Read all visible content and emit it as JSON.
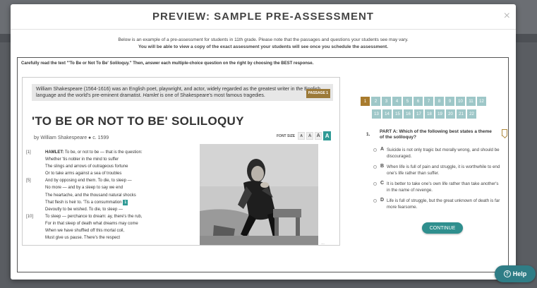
{
  "modal": {
    "title": "PREVIEW: SAMPLE PRE-ASSESSMENT",
    "close": "×",
    "intro_line1": "Below is an example of a pre-assessment for students in 11th grade. Please note that the passages and questions your students see may vary.",
    "intro_line2": "You will be able to view a copy of the exact assessment your students will see once you schedule the assessment."
  },
  "instruction": "Carefully read the text \"'To Be or Not To Be' Soliloquy.\" Then, answer each multiple-choice question on the right by choosing the BEST response.",
  "passage": {
    "bio_part1": "William Shakespeare (1564-1616) was an English poet, playwright, and actor, widely regarded as the greatest writer in the English language and the world's pre-eminent dramatist. ",
    "bio_italic": "Hamlet",
    "bio_part2": " is one of Shakespeare's most famous tragedies.",
    "tag": "PASSAGE 1",
    "title": "'TO BE OR NOT TO BE' SOLILOQUY",
    "author": "by William Shakespeare ● c. 1599",
    "font_size_label": "FONT SIZE",
    "font_btn": "A",
    "vocab_marker": "1",
    "lines": [
      {
        "num": "[1]",
        "speaker": "HAMLET:",
        "text": " To be, or not to be — that is the question:"
      },
      {
        "num": "",
        "speaker": "",
        "text": "Whether 'tis nobler in the mind to suffer"
      },
      {
        "num": "",
        "speaker": "",
        "text": "The slings and arrows of outrageous fortune"
      },
      {
        "num": "",
        "speaker": "",
        "text": "Or to take arms against a sea of troubles"
      },
      {
        "num": "[5]",
        "speaker": "",
        "text": "And by opposing end them. To die, to sleep —"
      },
      {
        "num": "",
        "speaker": "",
        "text": "No more — and by a sleep to say we end"
      },
      {
        "num": "",
        "speaker": "",
        "text": "The heartache, and the thousand natural shocks"
      },
      {
        "num": "",
        "speaker": "",
        "text": "That flesh is heir to. 'Tis a consummation "
      },
      {
        "num": "",
        "speaker": "",
        "text": "Devoutly to be wished. To die, to sleep —"
      },
      {
        "num": "[10]",
        "speaker": "",
        "text": "To sleep — perchance to dream: ay, there's the rub,"
      },
      {
        "num": "",
        "speaker": "",
        "text": "For in that sleep of death what dreams may come"
      },
      {
        "num": "",
        "speaker": "",
        "text": "When we have shuffled off this mortal coil,"
      },
      {
        "num": "",
        "speaker": "",
        "text": "Must give us pause. There's the respect"
      }
    ],
    "scroll_hint": "…"
  },
  "question_nav": {
    "row1": [
      "1",
      "2",
      "3",
      "4",
      "5",
      "6",
      "7",
      "8",
      "9",
      "10",
      "11",
      "12"
    ],
    "row2": [
      "13",
      "14",
      "15",
      "16",
      "17",
      "18",
      "19",
      "20",
      "21",
      "22"
    ],
    "active": "1"
  },
  "question": {
    "number": "1.",
    "text": "PART A: Which of the following best states a theme of the soliloquy?",
    "choices": [
      {
        "letter": "A",
        "text": "Suicide is not only tragic but morally wrong, and should be discouraged."
      },
      {
        "letter": "B",
        "text": "When life is full of pain and struggle, it is worthwhile to end one's life rather than suffer."
      },
      {
        "letter": "C",
        "text": "It is better to take one's own life rather than take another's in the name of revenge."
      },
      {
        "letter": "D",
        "text": "Life is full of struggle, but the great unknown of death is far more fearsome."
      }
    ],
    "continue_label": "CONTINUE"
  },
  "help_label": "Help",
  "help_icon": "?"
}
